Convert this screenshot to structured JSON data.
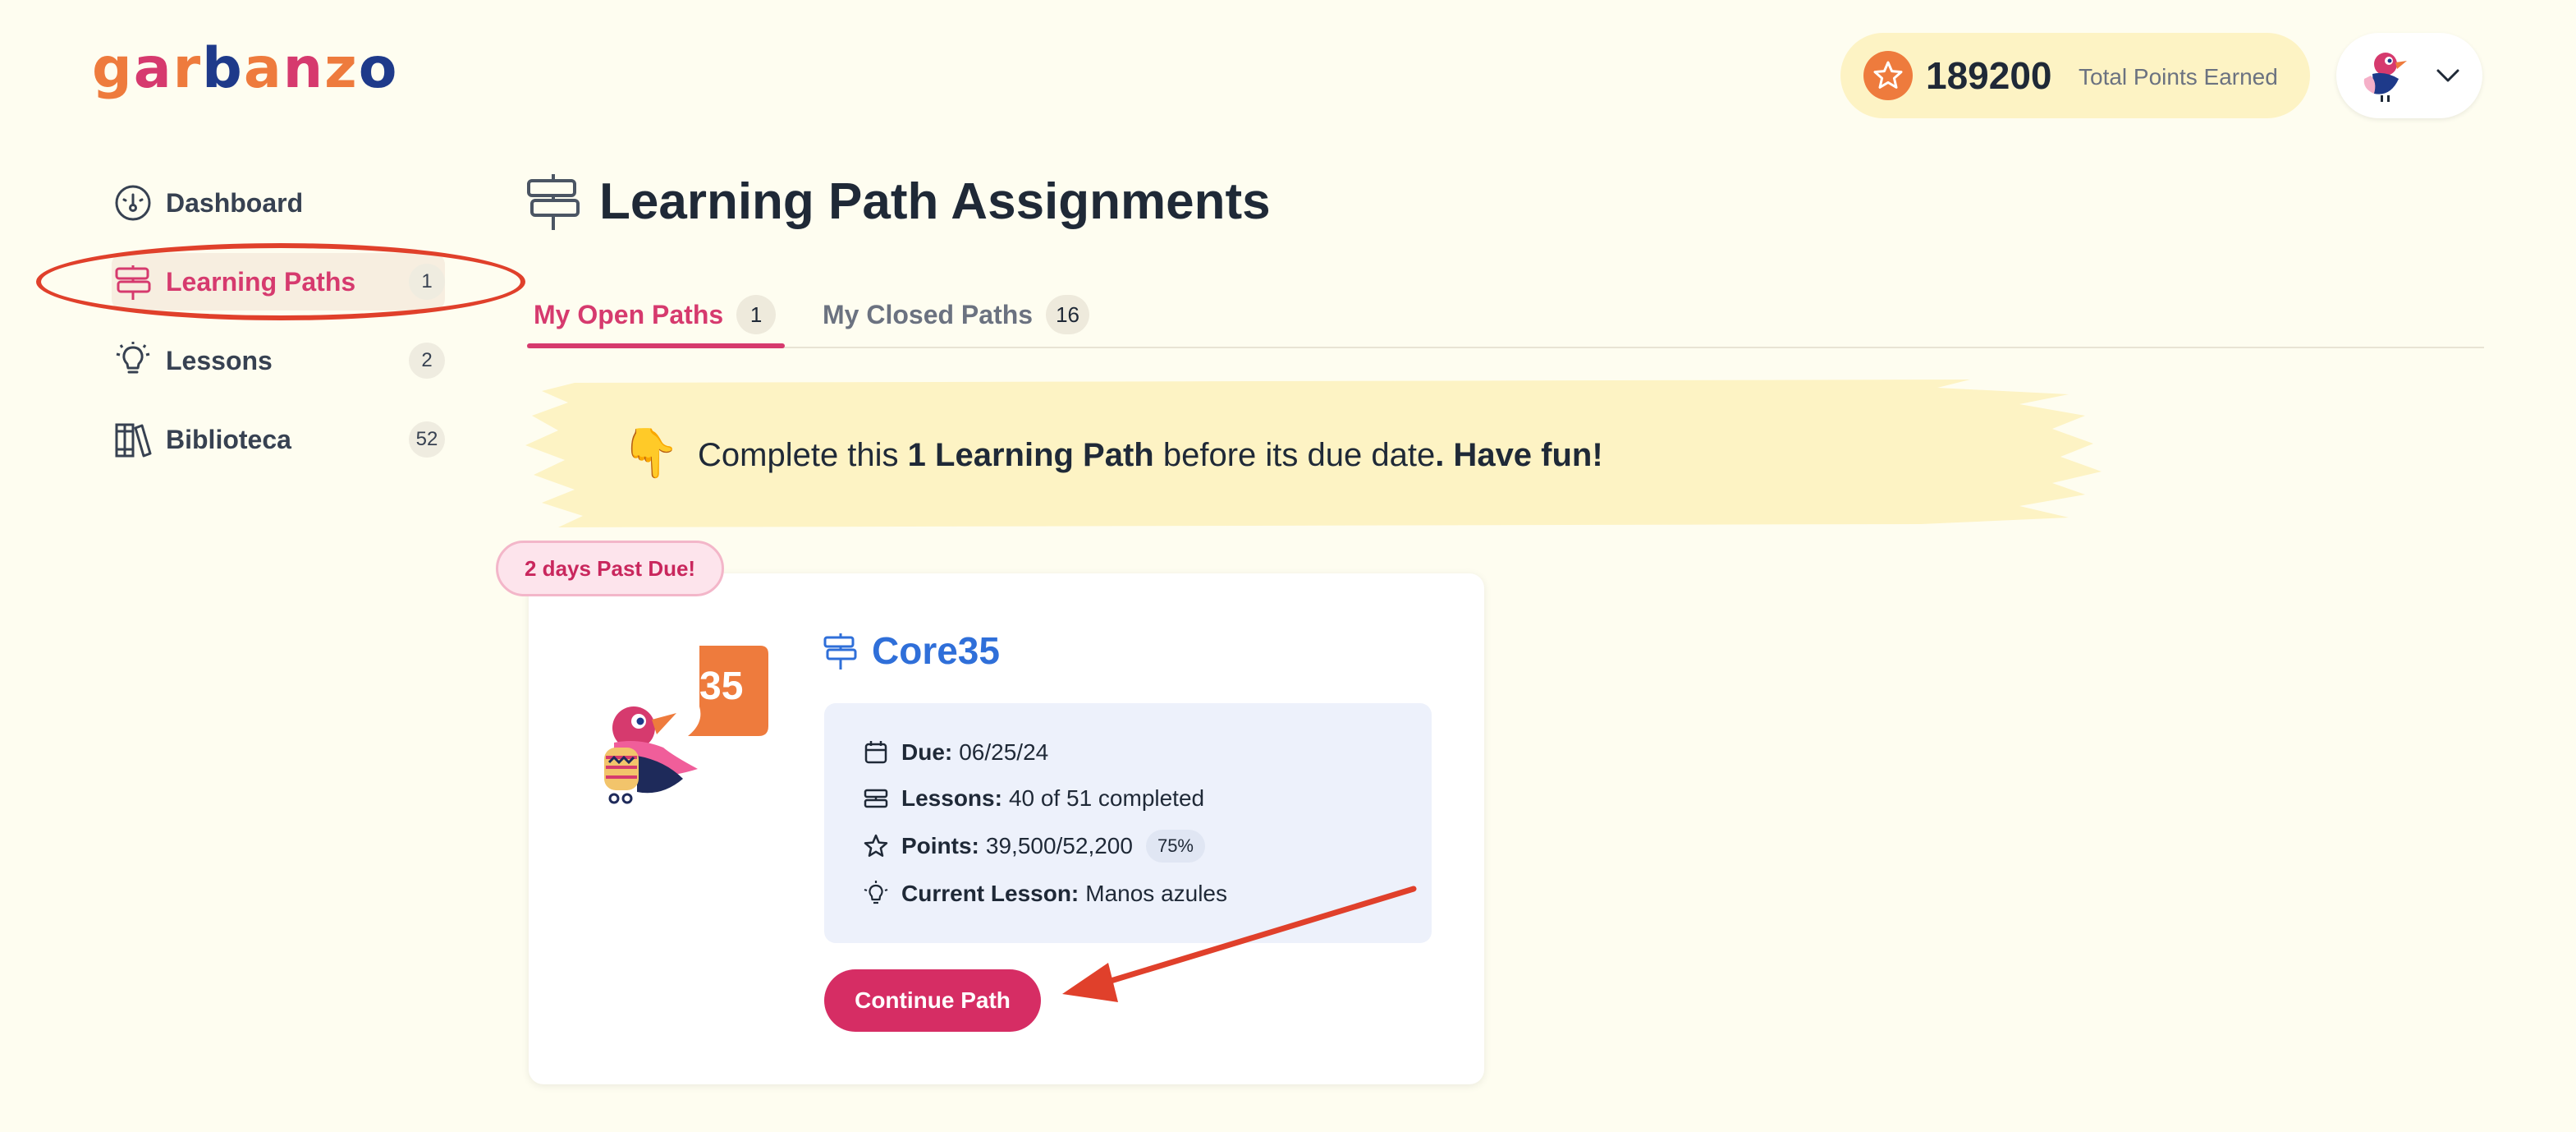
{
  "logo": {
    "letters": [
      "g",
      "a",
      "r",
      "b",
      "a",
      "n",
      "z",
      "o"
    ],
    "colors": [
      "#ee7b3d",
      "#d63a6e",
      "#ee7b3d",
      "#1e3a8a",
      "#ee7b3d",
      "#d63a6e",
      "#ee7b3d",
      "#1e3a8a"
    ]
  },
  "header": {
    "points_value": "189200",
    "points_label": "Total Points Earned"
  },
  "sidebar": {
    "items": [
      {
        "label": "Dashboard",
        "badge": "",
        "icon": "dashboard-gauge-icon"
      },
      {
        "label": "Learning Paths",
        "badge": "1",
        "icon": "signpost-icon",
        "active": true
      },
      {
        "label": "Lessons",
        "badge": "2",
        "icon": "lightbulb-icon"
      },
      {
        "label": "Biblioteca",
        "badge": "52",
        "icon": "library-books-icon"
      }
    ]
  },
  "page": {
    "title": "Learning Path Assignments"
  },
  "tabs": [
    {
      "label": "My Open Paths",
      "count": "1",
      "active": true
    },
    {
      "label": "My Closed Paths",
      "count": "16",
      "active": false
    }
  ],
  "banner": {
    "emoji": "👇",
    "pre": "Complete this ",
    "bold1": "1 Learning Path",
    "mid": " before its due date",
    "bold2": ". Have fun!"
  },
  "card": {
    "due_badge": "2 days Past Due!",
    "illustration_badge": "35",
    "title": "Core35",
    "due_label": "Due:",
    "due_value": "06/25/24",
    "lessons_label": "Lessons:",
    "lessons_value": "40 of 51 completed",
    "points_label": "Points:",
    "points_value": "39,500/52,200",
    "points_pct": "75%",
    "current_label": "Current Lesson:",
    "current_value": "Manos azules",
    "button": "Continue Path"
  },
  "colors": {
    "accent": "#d63a6e",
    "banner": "#fdf3c4",
    "link": "#2f6fd9",
    "annotation": "#e0402b"
  }
}
